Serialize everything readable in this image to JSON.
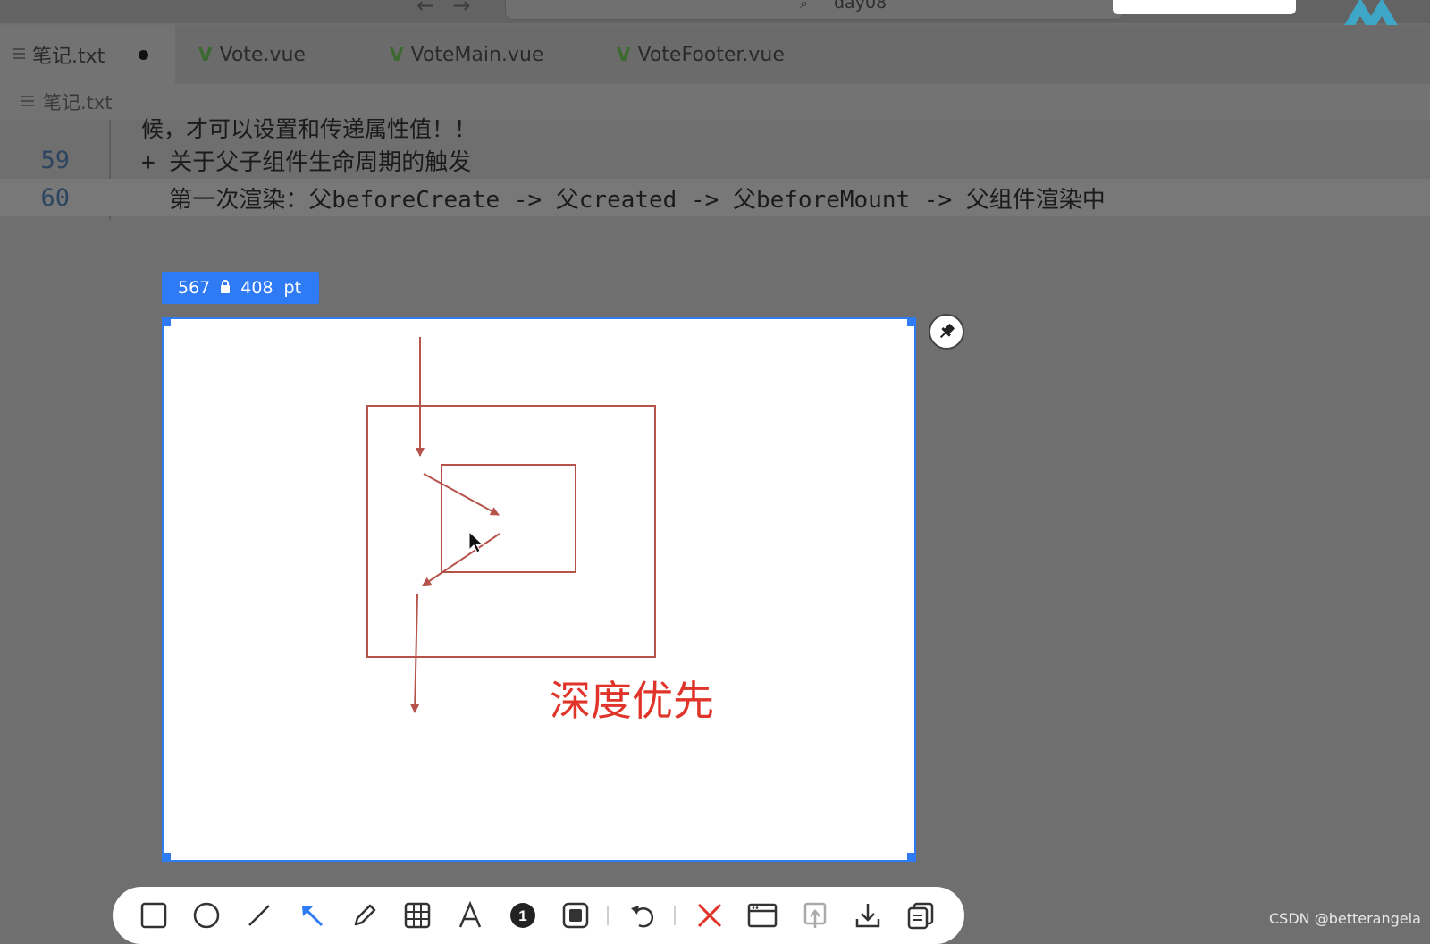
{
  "titlebar": {
    "search_text": "day08",
    "search_icon": "search-icon",
    "logo_icon": "vue-logo-icon"
  },
  "tabs": [
    {
      "label": "笔记.txt",
      "icon": "text-file-icon",
      "modified": true
    },
    {
      "label": "Vote.vue",
      "icon": "vue-icon"
    },
    {
      "label": "VoteMain.vue",
      "icon": "vue-icon"
    },
    {
      "label": "VoteFooter.vue",
      "icon": "vue-icon"
    }
  ],
  "breadcrumb": {
    "label": "笔记.txt",
    "icon": "text-file-icon"
  },
  "editor": {
    "lines": [
      {
        "number": "",
        "text": "候，才可以设置和传递属性值！！"
      },
      {
        "number": "59",
        "text": "+ 关于父子组件生命周期的触发"
      },
      {
        "number": "60",
        "text": "  第一次渲染：父beforeCreate -> 父created -> 父beforeMount -> 父组件渲染中"
      }
    ]
  },
  "screenshot_tool": {
    "width_value": "567",
    "height_value": "408",
    "unit": "pt",
    "lock_icon": "lock-icon",
    "pin_icon": "pin-icon",
    "caption": "深度优先",
    "colors": {
      "accent": "#2f7af5",
      "drawing": "#b5524a",
      "caption": "#e0342a"
    }
  },
  "toolbar": {
    "tools": [
      "rectangle-icon",
      "ellipse-icon",
      "line-icon",
      "arrow-icon",
      "pencil-icon",
      "mosaic-icon",
      "text-icon",
      "number-icon",
      "highlight-icon",
      "undo-icon",
      "close-icon",
      "window-icon",
      "upload-icon",
      "download-icon",
      "copy-icon"
    ]
  },
  "watermark": "CSDN @betterangela"
}
